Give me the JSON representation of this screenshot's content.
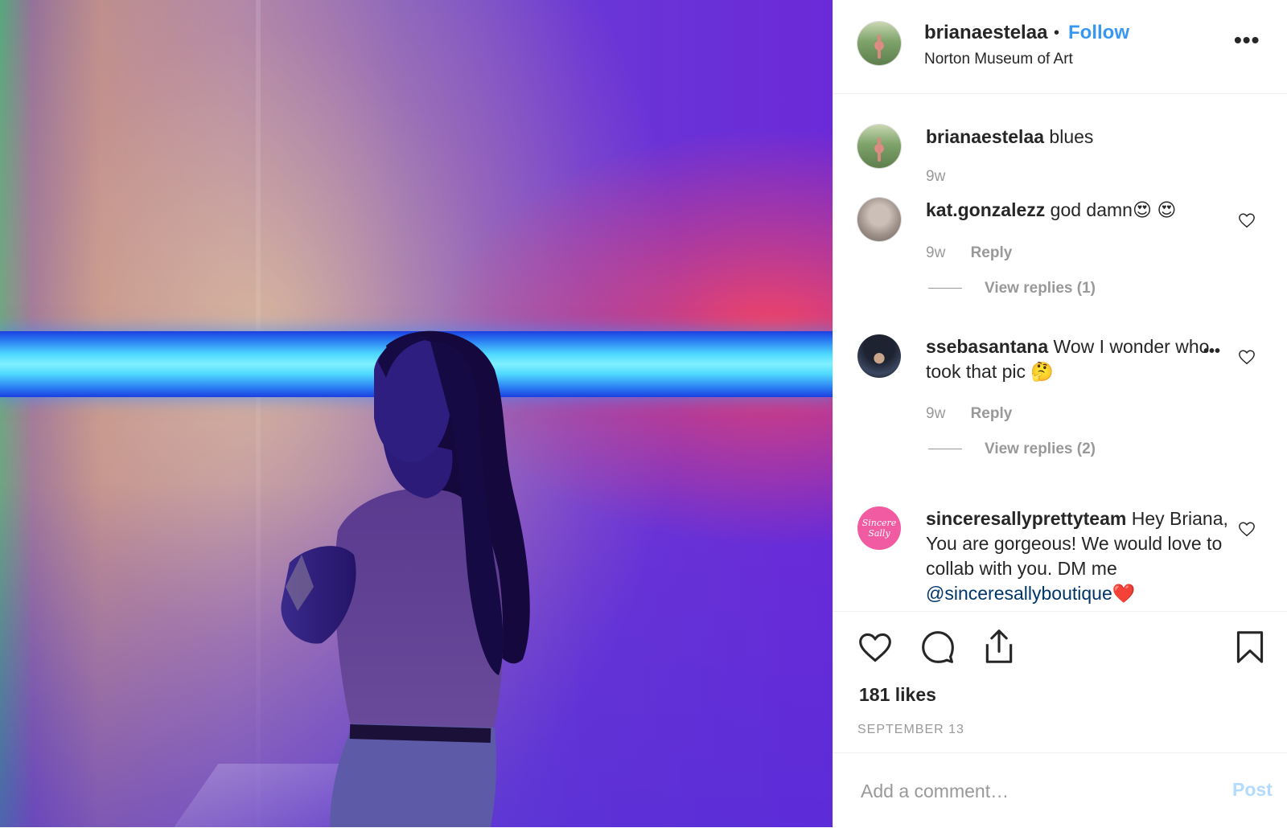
{
  "post": {
    "author": "brianaestelaa",
    "separator": "•",
    "follow_label": "Follow",
    "location": "Norton Museum of Art",
    "more_label": "•••"
  },
  "comments": [
    {
      "username": "brianaestelaa",
      "text": "blues",
      "time": "9w"
    },
    {
      "username": "kat.gonzalezz",
      "text": "god damn😍 😍",
      "time": "9w",
      "reply_label": "Reply",
      "view_replies": "View replies (1)"
    },
    {
      "username": "ssebasantana",
      "text": "Wow I wonder who took that pic 🤔",
      "time": "9w",
      "reply_label": "Reply",
      "view_replies": "View replies (2)",
      "options_label": "•••"
    },
    {
      "username": "sinceresallyprettyteam",
      "text": "Hey Briana, You are gorgeous! We would love to collab with you. DM me ",
      "mention": "@sinceresallyboutique",
      "trailing": "❤️",
      "avatar_text": "Sincere Sally"
    }
  ],
  "likes": "181 likes",
  "date": "SEPTEMBER 13",
  "add_comment": {
    "placeholder": "Add a comment…",
    "post_label": "Post"
  },
  "icons": [
    "heart-icon",
    "comment-icon",
    "share-icon",
    "bookmark-icon",
    "more-icon"
  ],
  "colors": {
    "link": "#3897f0",
    "muted": "#999999",
    "mention": "#003569",
    "post_disabled": "#b3dbff"
  }
}
